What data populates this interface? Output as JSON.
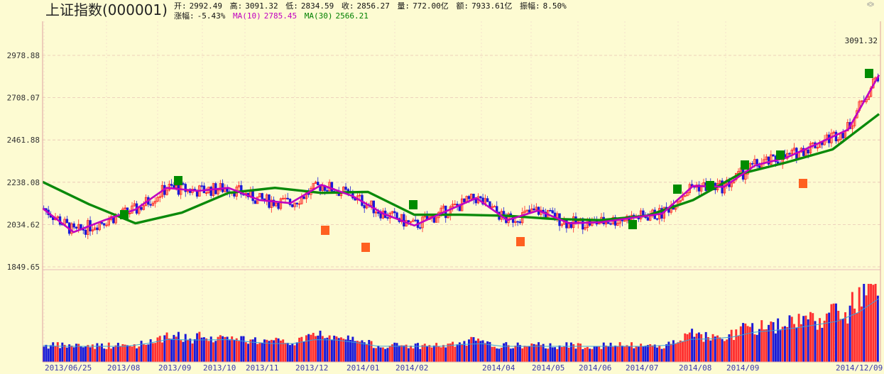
{
  "header": {
    "title": "上证指数(000001)",
    "open_label": "开:",
    "open": "2992.49",
    "high_label": "高:",
    "high": "3091.32",
    "low_label": "低:",
    "low": "2834.59",
    "close_label": "收:",
    "close": "2856.27",
    "volume_label": "量:",
    "volume": "772.00亿",
    "amount_label": "额:",
    "amount": "7933.61亿",
    "amplitude_label": "振幅:",
    "amplitude": "8.50%",
    "change_label": "涨幅:",
    "change": "-5.43%",
    "ma10_label": "MA(10)",
    "ma10": "2785.45",
    "ma30_label": "MA(30)",
    "ma30": "2566.21"
  },
  "colors": {
    "background": "#fdfbd2",
    "up": "#ff2020",
    "down": "#1a1ad8",
    "ma10": "#c000c0",
    "ma30": "#0a8a0a",
    "volume_ma": "#3aa0d8",
    "signal_green": "#008c00",
    "signal_orange": "#ff6020"
  },
  "chart_data": {
    "type": "candlestick",
    "title": "上证指数(000001)",
    "y_ticks": [
      1849.65,
      2034.62,
      2238.08,
      2461.88,
      2708.07,
      2978.88
    ],
    "y_tick_labels": [
      "1849.65",
      "2034.62",
      "2238.08",
      "2461.88",
      "2708.07",
      "2978.88"
    ],
    "ylim": [
      1800,
      3100
    ],
    "x_tick_labels": [
      "2013/06/25",
      "2013/08",
      "2013/09",
      "2013/10",
      "2013/11",
      "2013/12",
      "2014/01",
      "2014/02",
      "2014/04",
      "2014/05",
      "2014/06",
      "2014/07",
      "2014/08",
      "2014/09",
      "2014/12/09"
    ],
    "high_annotation": "3091.32",
    "grid": true,
    "series": [
      {
        "name": "MA(10)",
        "type": "line",
        "x": [
          "2013/06/25",
          "2013/07",
          "2013/08",
          "2013/09",
          "2013/09-b",
          "2013/10",
          "2013/10-b",
          "2013/11",
          "2013/11-b",
          "2013/12",
          "2013/12-b",
          "2014/01",
          "2014/01-b",
          "2014/02",
          "2014/02-b",
          "2014/03",
          "2014/04",
          "2014/04-b",
          "2014/05",
          "2014/06",
          "2014/07",
          "2014/08",
          "2014/08-b",
          "2014/09",
          "2014/10",
          "2014/11",
          "2014/11-b",
          "2014/12/09"
        ],
        "values": [
          2110,
          2000,
          2055,
          2105,
          2210,
          2195,
          2210,
          2150,
          2135,
          2225,
          2170,
          2085,
          2030,
          2095,
          2160,
          2055,
          2100,
          2040,
          2045,
          2065,
          2085,
          2220,
          2215,
          2325,
          2365,
          2440,
          2520,
          2850
        ]
      },
      {
        "name": "MA(30)",
        "type": "line",
        "x": [
          "2013/06/25",
          "2013/07",
          "2013/08",
          "2013/09",
          "2013/10",
          "2013/11",
          "2013/12",
          "2014/01",
          "2014/02",
          "2014/03",
          "2014/04",
          "2014/05",
          "2014/06",
          "2014/07",
          "2014/08",
          "2014/09",
          "2014/10",
          "2014/11",
          "2014/12/09"
        ],
        "values": [
          2240,
          2130,
          2040,
          2090,
          2185,
          2210,
          2185,
          2190,
          2080,
          2080,
          2075,
          2060,
          2055,
          2075,
          2150,
          2280,
          2340,
          2410,
          2610
        ]
      }
    ]
  }
}
